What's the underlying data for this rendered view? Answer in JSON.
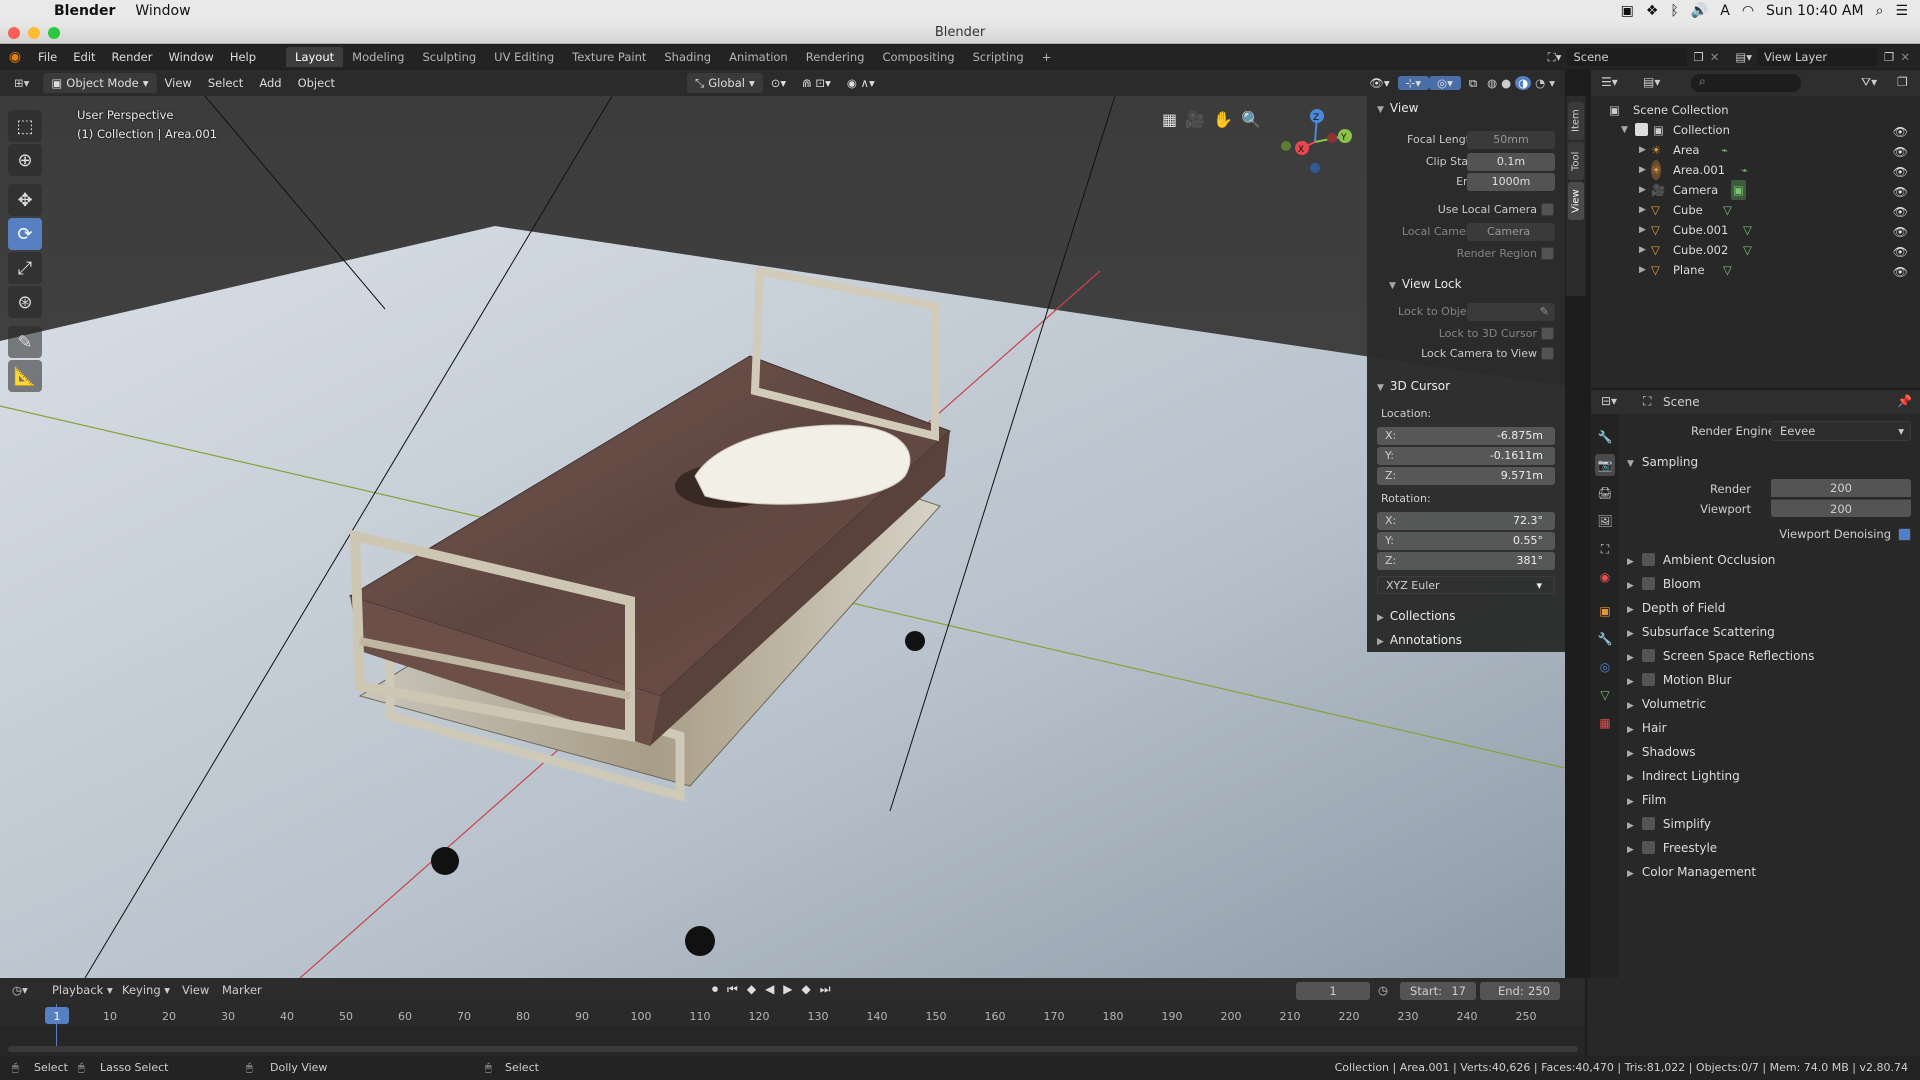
{
  "mac_menubar": {
    "app": "Blender",
    "menu": "Window",
    "clock": "Sun 10:40 AM"
  },
  "window_title": "Blender",
  "topbar": {
    "menus": [
      "File",
      "Edit",
      "Render",
      "Window",
      "Help"
    ],
    "workspaces": [
      "Layout",
      "Modeling",
      "Sculpting",
      "UV Editing",
      "Texture Paint",
      "Shading",
      "Animation",
      "Rendering",
      "Compositing",
      "Scripting"
    ],
    "add_tab": "+",
    "scene": "Scene",
    "view_layer": "View Layer"
  },
  "viewport_header": {
    "mode": "Object Mode",
    "menus": [
      "View",
      "Select",
      "Add",
      "Object"
    ],
    "orientation": "Global"
  },
  "viewport": {
    "perspective": "User Perspective",
    "collection_info": "(1) Collection | Area.001",
    "gizmo": {
      "z": "Z",
      "y": "Y",
      "x": "X"
    }
  },
  "n_panel": {
    "view": {
      "title": "View",
      "focal_length_label": "Focal Length",
      "focal_length": "50mm",
      "clip_start_label": "Clip Start",
      "clip_start": "0.1m",
      "clip_end_label": "End",
      "clip_end": "1000m",
      "use_local_camera": "Use Local Camera",
      "local_camera_label": "Local Camera",
      "local_camera": "Camera",
      "render_region": "Render Region"
    },
    "view_lock": {
      "title": "View Lock",
      "lock_to_object": "Lock to Object",
      "lock_to_cursor": "Lock to 3D Cursor",
      "lock_camera_to_view": "Lock Camera to View"
    },
    "cursor": {
      "title": "3D Cursor",
      "location_label": "Location:",
      "loc": [
        {
          "axis": "X:",
          "value": "-6.875m"
        },
        {
          "axis": "Y:",
          "value": "-0.1611m"
        },
        {
          "axis": "Z:",
          "value": "9.571m"
        }
      ],
      "rotation_label": "Rotation:",
      "rot": [
        {
          "axis": "X:",
          "value": "72.3°"
        },
        {
          "axis": "Y:",
          "value": "0.55°"
        },
        {
          "axis": "Z:",
          "value": "381°"
        }
      ],
      "rotation_mode": "XYZ Euler"
    },
    "collections": "Collections",
    "annotations": "Annotations",
    "tabs": [
      "Item",
      "Tool",
      "View"
    ]
  },
  "outliner": {
    "root": "Scene Collection",
    "collection": "Collection",
    "items": [
      "Area",
      "Area.001",
      "Camera",
      "Cube",
      "Cube.001",
      "Cube.002",
      "Plane"
    ]
  },
  "properties": {
    "scene": "Scene",
    "render_engine_label": "Render Engine",
    "render_engine": "Eevee",
    "sampling": "Sampling",
    "render_label": "Render",
    "render_samples": "200",
    "viewport_label": "Viewport",
    "viewport_samples": "200",
    "viewport_denoising": "Viewport Denoising",
    "sections": [
      {
        "label": "Ambient Occlusion",
        "check": true
      },
      {
        "label": "Bloom",
        "check": true
      },
      {
        "label": "Depth of Field",
        "check": false
      },
      {
        "label": "Subsurface Scattering",
        "check": false
      },
      {
        "label": "Screen Space Reflections",
        "check": true
      },
      {
        "label": "Motion Blur",
        "check": true
      },
      {
        "label": "Volumetric",
        "check": false
      },
      {
        "label": "Hair",
        "check": false
      },
      {
        "label": "Shadows",
        "check": false
      },
      {
        "label": "Indirect Lighting",
        "check": false
      },
      {
        "label": "Film",
        "check": false
      },
      {
        "label": "Simplify",
        "check": true
      },
      {
        "label": "Freestyle",
        "check": true
      },
      {
        "label": "Color Management",
        "check": false
      }
    ]
  },
  "timeline": {
    "menus": [
      "Playback",
      "Keying",
      "View",
      "Marker"
    ],
    "current_frame": "1",
    "start_label": "Start:",
    "start": "17",
    "end_label": "End:",
    "end": "250",
    "ticks": [
      "1",
      "10",
      "20",
      "30",
      "40",
      "50",
      "60",
      "70",
      "80",
      "90",
      "100",
      "110",
      "120",
      "130",
      "140",
      "150",
      "160",
      "170",
      "180",
      "190",
      "200",
      "210",
      "220",
      "230",
      "240",
      "250"
    ]
  },
  "statusbar": {
    "select": "Select",
    "lasso": "Lasso Select",
    "dolly": "Dolly View",
    "select2": "Select",
    "stats": "Collection | Area.001 | Verts:40,626 | Faces:40,470 | Tris:81,022 | Objects:0/7 | Mem: 74.0 MB | v2.80.74"
  },
  "colors": {
    "accent": "#5680c2",
    "axis_x": "#e8474f",
    "axis_y": "#8bc34a",
    "axis_z": "#4a88d8"
  }
}
